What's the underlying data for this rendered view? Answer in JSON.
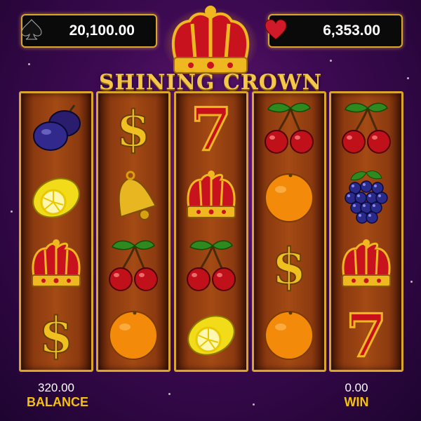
{
  "jackpots": {
    "spade_value": "20,100.00",
    "heart_value": "6,353.00"
  },
  "title": "SHINING CROWN",
  "reels": [
    [
      "plum",
      "lemon",
      "crown",
      "dollar"
    ],
    [
      "dollar",
      "bell",
      "cherries",
      "orange"
    ],
    [
      "seven",
      "crown",
      "cherries",
      "lemon"
    ],
    [
      "cherries",
      "orange",
      "dollar",
      "orange"
    ],
    [
      "cherries",
      "grapes",
      "crown",
      "seven"
    ]
  ],
  "footer": {
    "balance_value": "320.00",
    "balance_label": "BALANCE",
    "win_value": "0.00",
    "win_label": "WIN"
  },
  "colors": {
    "gold": "#f4c20d",
    "frame": "#d9a52a",
    "background": "#3d0a52"
  }
}
